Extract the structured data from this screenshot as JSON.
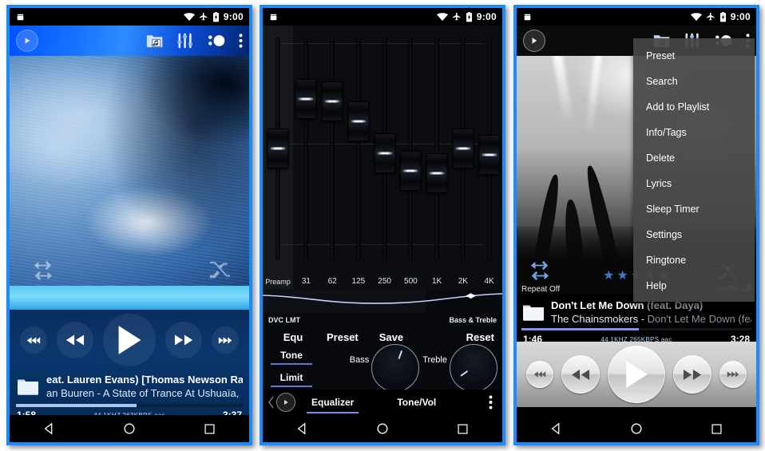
{
  "status_bar": {
    "time": "9:00",
    "icons": [
      "android-robot-icon",
      "wifi-icon",
      "airplane-mode-icon",
      "battery-charging-icon"
    ]
  },
  "nav_bar": {
    "back": "back-triangle-icon",
    "home": "home-circle-icon",
    "recents": "recents-square-icon"
  },
  "phone1": {
    "toolbar": {
      "play_badge": "play-badge-icon",
      "folder_music": "folder-music-icon",
      "equalizer": "equalizer-sliders-icon",
      "visualizer": "visualizer-icon",
      "overflow": "overflow-menu-icon"
    },
    "album_art": {
      "name": "blue-vortex-album-art",
      "repeat_icon": "repeat-icon",
      "shuffle_icon": "shuffle-icon"
    },
    "transport": {
      "prev_track": "skip-previous-icon",
      "rewind": "rewind-icon",
      "play": "play-icon",
      "fast_forward": "fast-forward-icon",
      "next_track": "skip-next-icon"
    },
    "track": {
      "folder_icon": "folder-icon",
      "title": "eat. Lauren Evans) [Thomas Newson Radio E",
      "artist": "an Buuren - A State of Trance At Ushuaïa, Ibiz",
      "elapsed": "1:58",
      "duration": "3:37",
      "meta": "44.1KHZ  263KBPS  aac",
      "progress_percent": 53
    }
  },
  "phone2": {
    "equalizer": {
      "bands": [
        "Preamp",
        "31",
        "62",
        "125",
        "250",
        "500",
        "1K",
        "2K",
        "4K"
      ],
      "values_percent": [
        50,
        28,
        29,
        38,
        52,
        60,
        61,
        50,
        53
      ],
      "curve_arrows": "◀▶",
      "dvc_label": "DVC LMT",
      "bass_treble_label": "Bass & Treble"
    },
    "buttons": {
      "equ": "Equ",
      "preset": "Preset",
      "save": "Save",
      "reset": "Reset"
    },
    "side_buttons": [
      "Tone",
      "Limit"
    ],
    "knobs": [
      {
        "label": "Bass",
        "angle_deg": 20
      },
      {
        "label": "Treble",
        "angle_deg": -125
      }
    ],
    "tabs": [
      {
        "label": "Equalizer",
        "active": true
      },
      {
        "label": "Tone/Vol",
        "active": false
      }
    ],
    "tab_overflow": "overflow-menu-icon",
    "tab_play": "play-small-icon",
    "tab_back": "chevron-left-icon"
  },
  "phone3": {
    "toolbar": {
      "play_badge": "play-badge-icon",
      "folder_music": "folder-music-icon",
      "equalizer": "equalizer-sliders-icon",
      "visualizer": "visualizer-icon",
      "overflow": "overflow-menu-icon"
    },
    "album_art": {
      "name": "concert-crowd-album-art"
    },
    "repeat_label": "Repeat Off",
    "shuffle_label": "Shuffle Off",
    "rating": {
      "total": 5,
      "filled": 3
    },
    "track": {
      "folder_icon": "folder-icon",
      "title": "Don't Let Me Down",
      "title_suffix": " (feat. Daya)",
      "artist": "The Chainsmokers - ",
      "artist_suffix": "Don't Let Me Down (feat...",
      "elapsed": "1:46",
      "duration": "3:28",
      "meta": "44.1KHZ  265KBPS  aac",
      "progress_percent": 51
    },
    "transport": {
      "prev_track": "skip-previous-icon",
      "rewind": "rewind-icon",
      "play": "play-icon",
      "fast_forward": "fast-forward-icon",
      "next_track": "skip-next-icon"
    },
    "menu_items": [
      "Preset",
      "Search",
      "Add to Playlist",
      "Info/Tags",
      "Delete",
      "Lyrics",
      "Sleep Timer",
      "Settings",
      "Ringtone",
      "Help"
    ]
  },
  "colors": {
    "frame_blue": "#1a8cff",
    "accent_blue": "#7b93e8",
    "star_blue": "#3f78c2",
    "menu_bg": "#464646"
  }
}
